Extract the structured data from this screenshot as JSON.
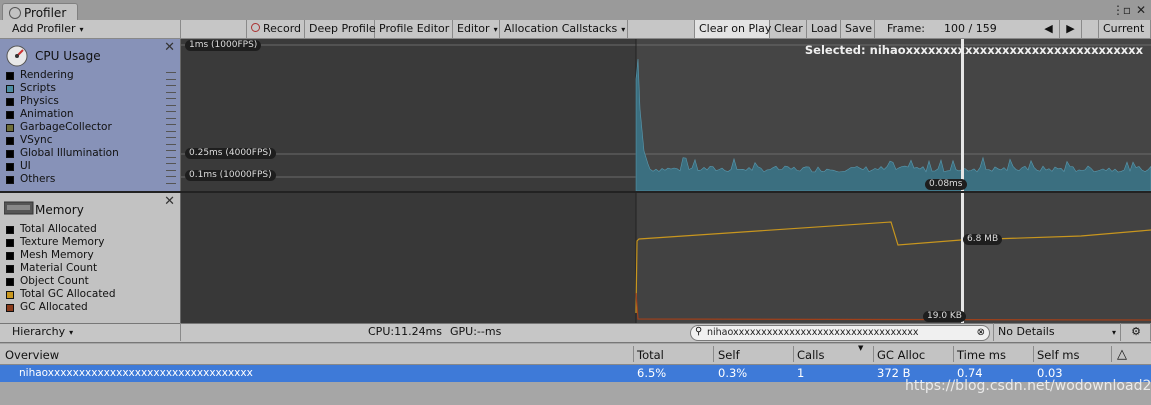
{
  "window": {
    "tab_title": "Profiler",
    "menu_icon": "kebab-menu-icon",
    "maximize_icon": "maximize-icon",
    "close_icon": "close-icon"
  },
  "toolbar": {
    "add_profiler": "Add Profiler",
    "record": "Record",
    "deep_profile": "Deep Profile",
    "profile_editor": "Profile Editor",
    "editor": "Editor",
    "allocation_callstacks": "Allocation Callstacks",
    "clear_on_play": "Clear on Play",
    "clear": "Clear",
    "load": "Load",
    "save": "Save",
    "frame_label": "Frame:",
    "frame_value": "100 / 159",
    "current": "Current"
  },
  "cpu_panel": {
    "title": "CPU Usage",
    "legend": [
      {
        "label": "Rendering",
        "color": "#000000"
      },
      {
        "label": "Scripts",
        "color": "#4c8ea3"
      },
      {
        "label": "Physics",
        "color": "#000000"
      },
      {
        "label": "Animation",
        "color": "#000000"
      },
      {
        "label": "GarbageCollector",
        "color": "#6e6e3a"
      },
      {
        "label": "VSync",
        "color": "#000000"
      },
      {
        "label": "Global Illumination",
        "color": "#000000"
      },
      {
        "label": "UI",
        "color": "#000000"
      },
      {
        "label": "Others",
        "color": "#000000"
      }
    ]
  },
  "memory_panel": {
    "title": "Memory",
    "legend": [
      {
        "label": "Total Allocated",
        "color": "#000000"
      },
      {
        "label": "Texture Memory",
        "color": "#000000"
      },
      {
        "label": "Mesh Memory",
        "color": "#000000"
      },
      {
        "label": "Material Count",
        "color": "#000000"
      },
      {
        "label": "Object Count",
        "color": "#000000"
      },
      {
        "label": "Total GC Allocated",
        "color": "#c8961e"
      },
      {
        "label": "GC Allocated",
        "color": "#8a3a1a"
      }
    ]
  },
  "cpu_graph": {
    "label_1ms": "1ms (1000FPS)",
    "label_025ms": "0.25ms (4000FPS)",
    "label_01ms": "0.1ms (10000FPS)",
    "selected": "Selected: nihaoxxxxxxxxxxxxxxxxxxxxxxxxxxxxxxxx",
    "frame_value": "0.08ms",
    "series_color": "#3b6f80"
  },
  "memory_graph": {
    "total_gc_value": "6.8 MB",
    "gc_alloc_value": "19.0 KB",
    "total_gc_color": "#c8961e",
    "gc_alloc_color": "#a0401a"
  },
  "bottom_bar": {
    "view_mode": "Hierarchy",
    "cpu": "CPU:11.24ms",
    "gpu": "GPU:--ms",
    "search_value": "nihaoxxxxxxxxxxxxxxxxxxxxxxxxxxxxxxxxx",
    "details": "No Details"
  },
  "table": {
    "columns": [
      "Overview",
      "Total",
      "Self",
      "Calls",
      "GC Alloc",
      "Time ms",
      "Self ms"
    ],
    "warning_icon": "warning-icon",
    "rows": [
      {
        "name": "nihaoxxxxxxxxxxxxxxxxxxxxxxxxxxxxxxxxx",
        "total": "6.5%",
        "self": "0.3%",
        "calls": "1",
        "gc_alloc": "372 B",
        "time_ms": "0.74",
        "self_ms": "0.03"
      }
    ]
  },
  "watermark": "https://blog.csdn.net/wodownload2"
}
